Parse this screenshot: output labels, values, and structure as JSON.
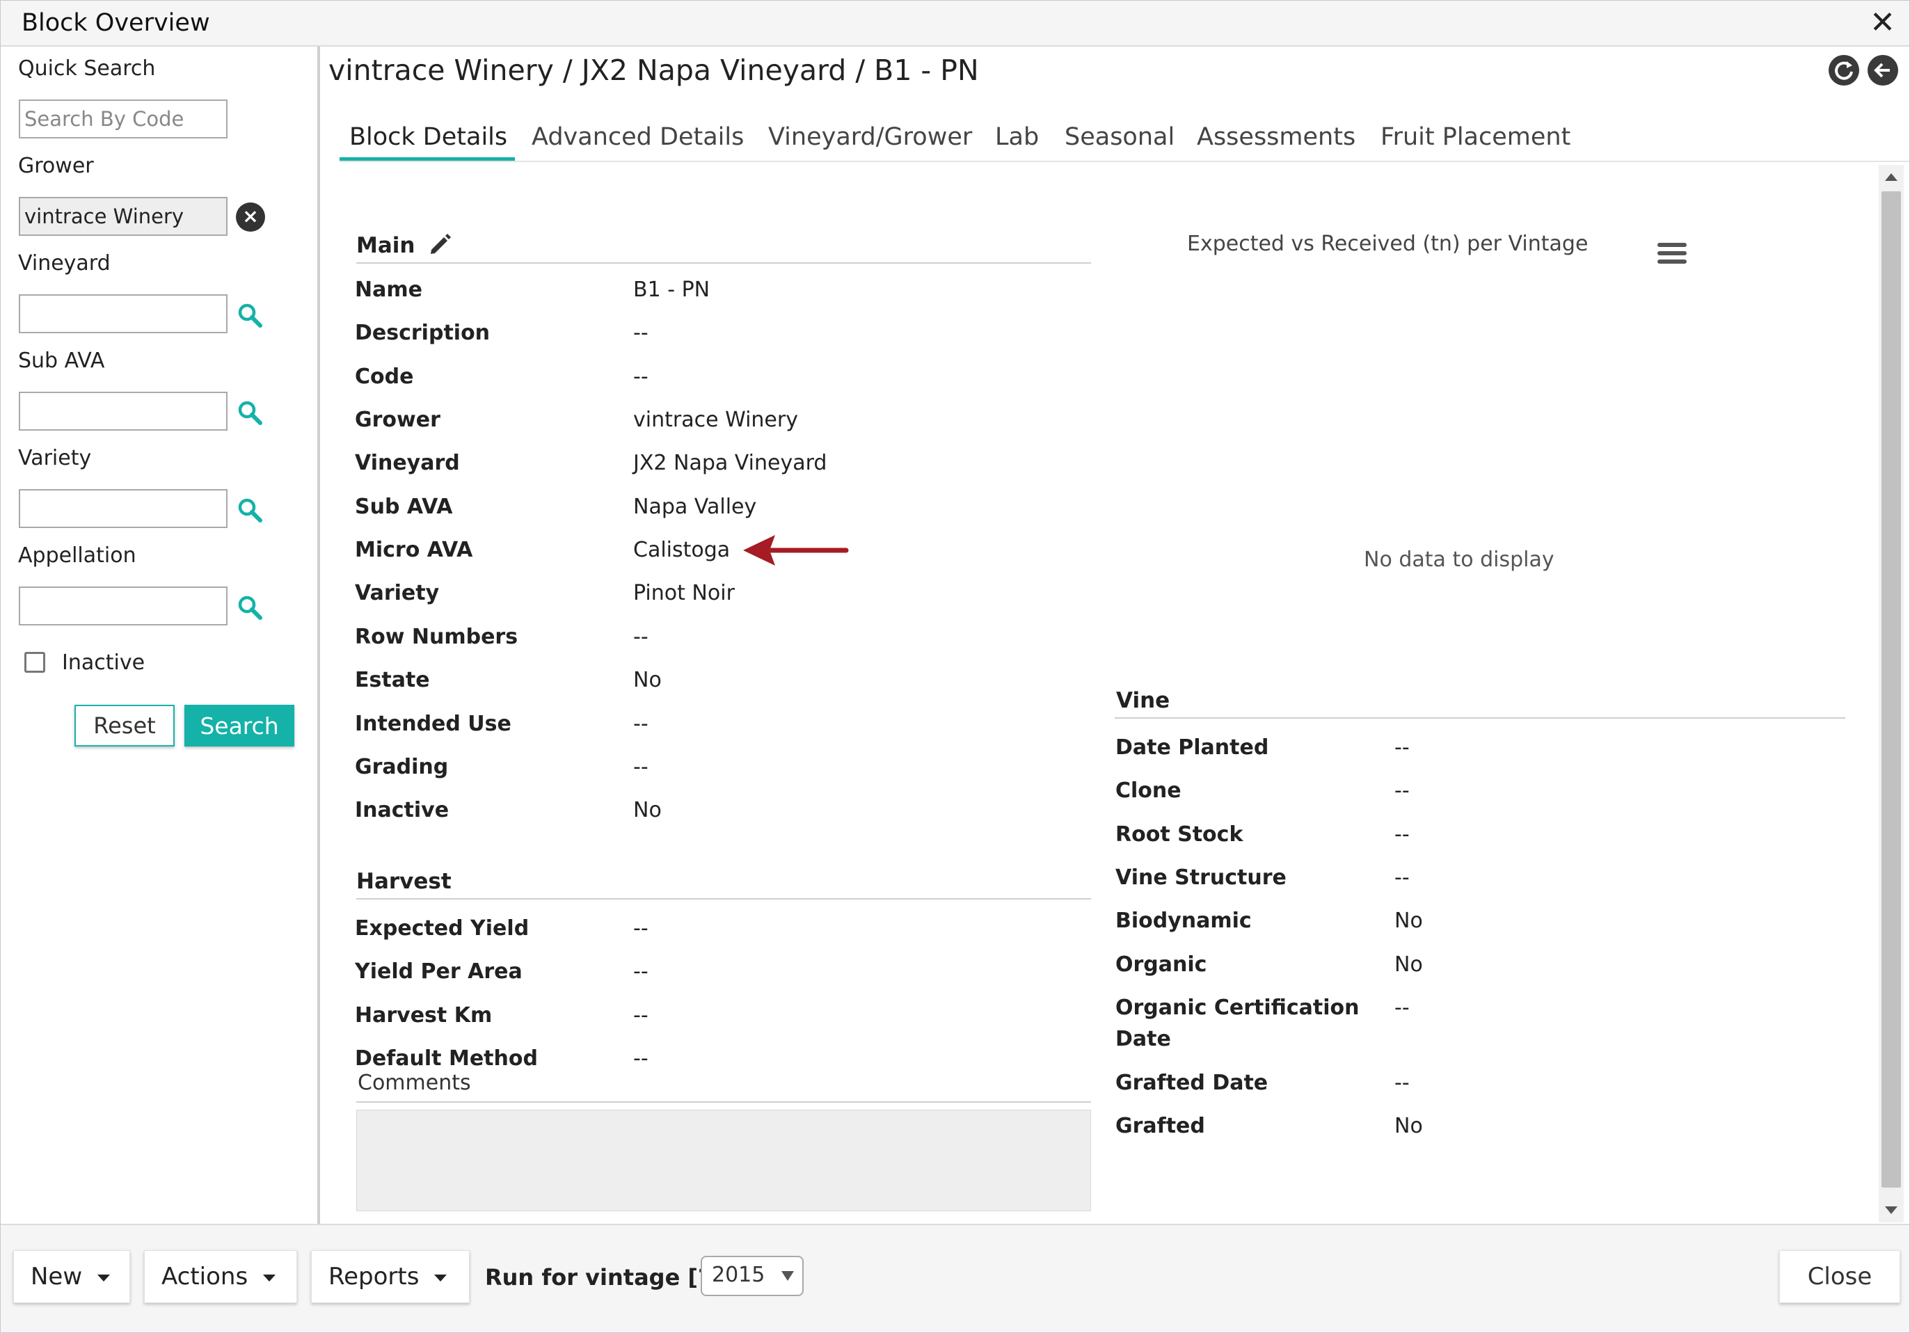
{
  "window": {
    "title": "Block Overview",
    "close_icon": "close-icon"
  },
  "sidebar": {
    "quick_search_label": "Quick Search",
    "quick_search_placeholder": "Search By Code",
    "grower_label": "Grower",
    "grower_value": "vintrace Winery",
    "vineyard_label": "Vineyard",
    "vineyard_value": "",
    "sub_ava_label": "Sub AVA",
    "sub_ava_value": "",
    "variety_label": "Variety",
    "variety_value": "",
    "appellation_label": "Appellation",
    "appellation_value": "",
    "inactive_label": "Inactive",
    "inactive_checked": false,
    "reset_label": "Reset",
    "search_label": "Search"
  },
  "header": {
    "breadcrumb": "vintrace Winery / JX2 Napa Vineyard / B1 - PN",
    "icons": [
      "refresh-icon",
      "back-arrow-icon"
    ]
  },
  "tabs": [
    {
      "label": "Block Details",
      "active": true
    },
    {
      "label": "Advanced Details",
      "active": false
    },
    {
      "label": "Vineyard/Grower",
      "active": false
    },
    {
      "label": "Lab",
      "active": false
    },
    {
      "label": "Seasonal",
      "active": false
    },
    {
      "label": "Assessments",
      "active": false
    },
    {
      "label": "Fruit Placement",
      "active": false
    }
  ],
  "main_section": {
    "title": "Main",
    "fields": [
      {
        "label": "Name",
        "value": "B1 - PN"
      },
      {
        "label": "Description",
        "value": "--"
      },
      {
        "label": "Code",
        "value": "--"
      },
      {
        "label": "Grower",
        "value": "vintrace Winery"
      },
      {
        "label": "Vineyard",
        "value": "JX2 Napa Vineyard"
      },
      {
        "label": "Sub AVA",
        "value": "Napa Valley"
      },
      {
        "label": "Micro AVA",
        "value": "Calistoga"
      },
      {
        "label": "Variety",
        "value": "Pinot Noir"
      },
      {
        "label": "Row Numbers",
        "value": "--"
      },
      {
        "label": "Estate",
        "value": "No"
      },
      {
        "label": "Intended Use",
        "value": "--"
      },
      {
        "label": "Grading",
        "value": "--"
      },
      {
        "label": "Inactive",
        "value": "No"
      }
    ]
  },
  "harvest_section": {
    "title": "Harvest",
    "fields": [
      {
        "label": "Expected Yield",
        "value": "--"
      },
      {
        "label": "Yield Per Area",
        "value": "--"
      },
      {
        "label": "Harvest Km",
        "value": "--"
      },
      {
        "label": "Default Method",
        "value": "--"
      }
    ]
  },
  "comments": {
    "label": "Comments",
    "value": ""
  },
  "chart": {
    "title": "Expected vs Received (tn) per Vintage",
    "empty_text": "No data to display"
  },
  "vine_section": {
    "title": "Vine",
    "fields": [
      {
        "label": "Date Planted",
        "value": "--"
      },
      {
        "label": "Clone",
        "value": "--"
      },
      {
        "label": "Root Stock",
        "value": "--"
      },
      {
        "label": "Vine Structure",
        "value": "--"
      },
      {
        "label": "Biodynamic",
        "value": "No"
      },
      {
        "label": "Organic",
        "value": "No"
      },
      {
        "label": "Organic Certification",
        "label_line2": "Date",
        "value": "--"
      },
      {
        "label": "Grafted Date",
        "value": "--"
      },
      {
        "label": "Grafted",
        "value": "No"
      }
    ]
  },
  "annotation": {
    "arrow_color": "#a51c24",
    "points_to": "Micro AVA"
  },
  "footer": {
    "new_label": "New",
    "actions_label": "Actions",
    "reports_label": "Reports",
    "run_for_vintage_label": "Run for vintage [?]",
    "vintage_value": "2015",
    "close_label": "Close"
  },
  "colors": {
    "accent": "#14b2a8",
    "arrow": "#a51c24"
  }
}
